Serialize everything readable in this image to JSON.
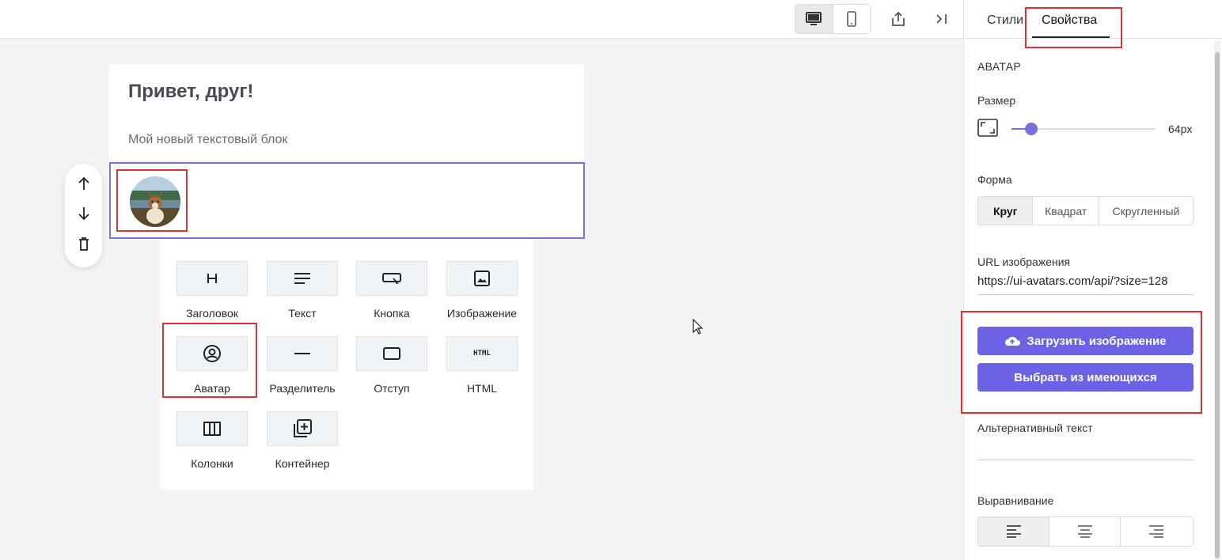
{
  "canvas": {
    "heading": "Привет, друг!",
    "paragraph": "Мой новый текстовый блок"
  },
  "toolbar": {
    "desktop_icon": "desktop-icon",
    "mobile_icon": "mobile-icon",
    "share_icon": "share-icon",
    "collapse_icon": "collapse-panel-icon"
  },
  "block_tools": [
    "arrow-up-icon",
    "arrow-down-icon",
    "trash-icon"
  ],
  "blocks": [
    {
      "label": "Заголовок",
      "icon": "heading-icon"
    },
    {
      "label": "Текст",
      "icon": "text-icon"
    },
    {
      "label": "Кнопка",
      "icon": "button-icon"
    },
    {
      "label": "Изображение",
      "icon": "image-icon"
    },
    {
      "label": "Аватар",
      "icon": "avatar-icon"
    },
    {
      "label": "Разделитель",
      "icon": "divider-icon"
    },
    {
      "label": "Отступ",
      "icon": "spacer-icon"
    },
    {
      "label": "HTML",
      "icon": "html-icon"
    },
    {
      "label": "Колонки",
      "icon": "columns-icon"
    },
    {
      "label": "Контейнер",
      "icon": "container-icon"
    }
  ],
  "panel": {
    "tabs": [
      {
        "label": "Стили"
      },
      {
        "label": "Свойства"
      }
    ],
    "section_title": "АВАТАР",
    "size": {
      "label": "Размер",
      "value_text": "64px",
      "fraction": 0.14
    },
    "shape": {
      "label": "Форма",
      "options": [
        "Круг",
        "Квадрат",
        "Скругленный"
      ],
      "selected": "Круг"
    },
    "url": {
      "label": "URL изображения",
      "value": "https://ui-avatars.com/api/?size=128"
    },
    "upload_label": "Загрузить изображение",
    "choose_label": "Выбрать из имеющихся",
    "alt": {
      "label": "Альтернативный текст",
      "value": ""
    },
    "align": {
      "label": "Выравнивание",
      "options": [
        "align-left-icon",
        "align-center-icon",
        "align-right-icon"
      ],
      "selected": "align-left-icon"
    }
  },
  "colors": {
    "accent": "#6c62e6",
    "highlight": "#e03131",
    "selection": "#7b72d9"
  }
}
